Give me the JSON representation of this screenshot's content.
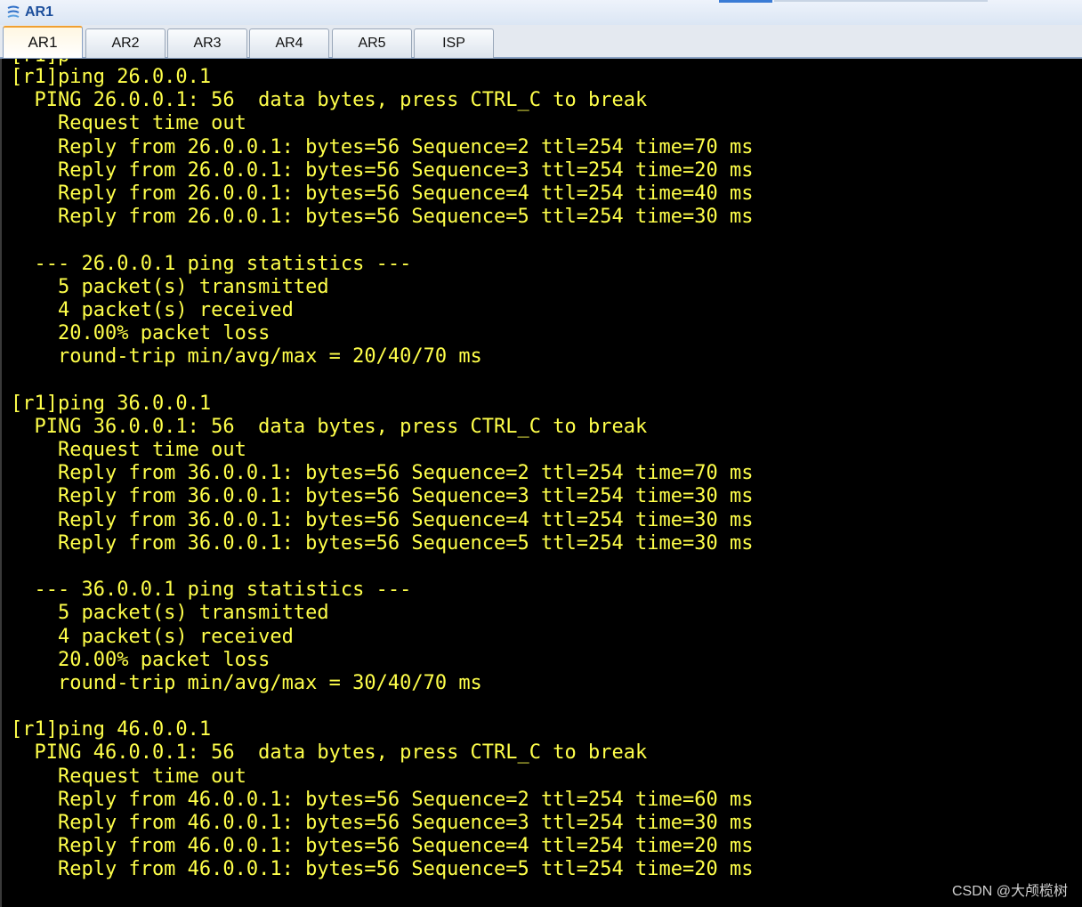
{
  "window": {
    "title": "AR1"
  },
  "tabs": [
    {
      "label": "AR1",
      "active": true
    },
    {
      "label": "AR2",
      "active": false
    },
    {
      "label": "AR3",
      "active": false
    },
    {
      "label": "AR4",
      "active": false
    },
    {
      "label": "AR5",
      "active": false
    },
    {
      "label": "ISP",
      "active": false
    }
  ],
  "terminal": {
    "text_color": "#ffff4a",
    "background": "#000000",
    "cutoff_line": "[r1]p",
    "lines": [
      "[r1]ping 26.0.0.1",
      "  PING 26.0.0.1: 56  data bytes, press CTRL_C to break",
      "    Request time out",
      "    Reply from 26.0.0.1: bytes=56 Sequence=2 ttl=254 time=70 ms",
      "    Reply from 26.0.0.1: bytes=56 Sequence=3 ttl=254 time=20 ms",
      "    Reply from 26.0.0.1: bytes=56 Sequence=4 ttl=254 time=40 ms",
      "    Reply from 26.0.0.1: bytes=56 Sequence=5 ttl=254 time=30 ms",
      "",
      "  --- 26.0.0.1 ping statistics ---",
      "    5 packet(s) transmitted",
      "    4 packet(s) received",
      "    20.00% packet loss",
      "    round-trip min/avg/max = 20/40/70 ms",
      "",
      "[r1]ping 36.0.0.1",
      "  PING 36.0.0.1: 56  data bytes, press CTRL_C to break",
      "    Request time out",
      "    Reply from 36.0.0.1: bytes=56 Sequence=2 ttl=254 time=70 ms",
      "    Reply from 36.0.0.1: bytes=56 Sequence=3 ttl=254 time=30 ms",
      "    Reply from 36.0.0.1: bytes=56 Sequence=4 ttl=254 time=30 ms",
      "    Reply from 36.0.0.1: bytes=56 Sequence=5 ttl=254 time=30 ms",
      "",
      "  --- 36.0.0.1 ping statistics ---",
      "    5 packet(s) transmitted",
      "    4 packet(s) received",
      "    20.00% packet loss",
      "    round-trip min/avg/max = 30/40/70 ms",
      "",
      "[r1]ping 46.0.0.1",
      "  PING 46.0.0.1: 56  data bytes, press CTRL_C to break",
      "    Request time out",
      "    Reply from 46.0.0.1: bytes=56 Sequence=2 ttl=254 time=60 ms",
      "    Reply from 46.0.0.1: bytes=56 Sequence=3 ttl=254 time=30 ms",
      "    Reply from 46.0.0.1: bytes=56 Sequence=4 ttl=254 time=20 ms",
      "    Reply from 46.0.0.1: bytes=56 Sequence=5 ttl=254 time=20 ms"
    ]
  },
  "watermark": "CSDN @大颅榄树"
}
